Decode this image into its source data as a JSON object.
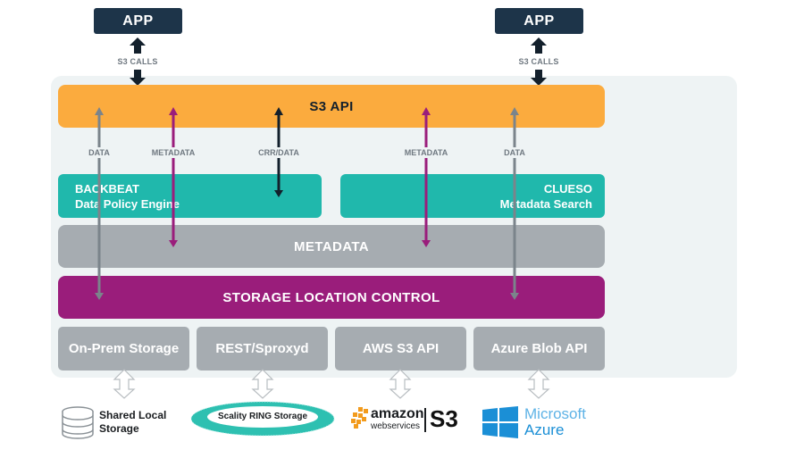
{
  "apps": [
    {
      "label": "APP",
      "calls_label": "S3 CALLS"
    },
    {
      "label": "APP",
      "calls_label": "S3 CALLS"
    }
  ],
  "layers": {
    "s3_api": "S3 API",
    "metadata": "METADATA",
    "storage_location_control": "STORAGE LOCATION CONTROL"
  },
  "components": {
    "backbeat": {
      "title": "BACKBEAT",
      "subtitle": "Data Policy Engine"
    },
    "clueso": {
      "title": "CLUESO",
      "subtitle": "Metadata Search"
    }
  },
  "flows": [
    {
      "label": "DATA",
      "color": "#7b848b"
    },
    {
      "label": "METADATA",
      "color": "#9a1d7b"
    },
    {
      "label": "CRR/DATA",
      "color": "#13202c"
    },
    {
      "label": "METADATA",
      "color": "#9a1d7b"
    },
    {
      "label": "DATA",
      "color": "#7b848b"
    }
  ],
  "backends": [
    {
      "label": "On-Prem Storage",
      "target": "Shared Local Storage"
    },
    {
      "label": "REST/Sproxyd",
      "target": "Scality RING Storage"
    },
    {
      "label": "AWS S3 API",
      "target": "amazon web services S3"
    },
    {
      "label": "Azure Blob API",
      "target": "Microsoft Azure"
    }
  ],
  "logos": {
    "shared_local": {
      "line1": "Shared Local",
      "line2": "Storage"
    },
    "ring": "Scality RING Storage",
    "amazon": {
      "word": "amazon",
      "sub": "webservices",
      "product": "S3"
    },
    "azure": {
      "line1": "Microsoft",
      "line2": "Azure"
    }
  },
  "colors": {
    "app": "#1d3449",
    "s3_api": "#fbab3e",
    "teal": "#20b8ac",
    "metadata": "#a6acb1",
    "storage_control": "#9a1d7b",
    "panel": "#eef3f4",
    "azure": "#1b8fd6",
    "aws_orange": "#f29b1d"
  }
}
